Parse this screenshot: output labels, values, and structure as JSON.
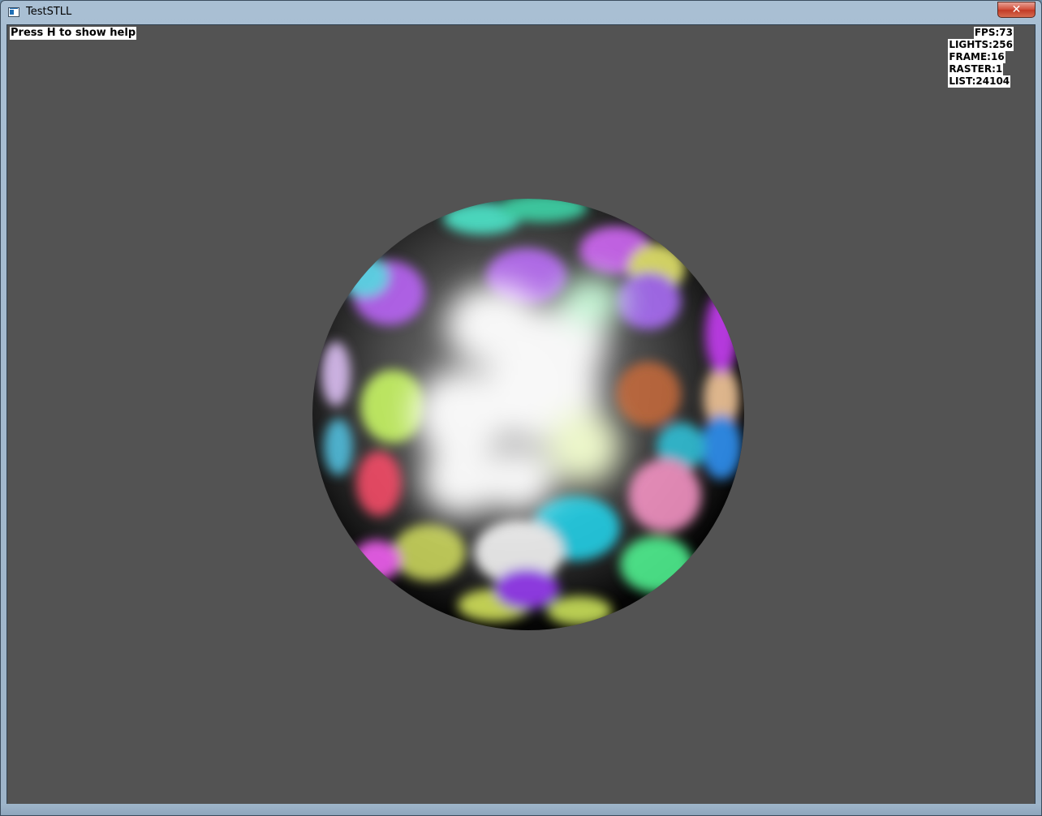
{
  "window": {
    "title": "TestSTLL",
    "close_symbol": "✕",
    "icon": "app-window-icon"
  },
  "overlay": {
    "help": "Press H to show help",
    "stats": [
      "FPS:73",
      "LIGHTS:256",
      "FRAME:16",
      "RASTER:1",
      "LIST:24104"
    ]
  },
  "scene": {
    "background_color": "#535353",
    "object": "lit-sphere",
    "light_colors": [
      "#ffffff",
      "#ff66cc",
      "#33e0e0",
      "#ccff66",
      "#ff4d6a",
      "#b366ff",
      "#3399ff",
      "#c86a3a"
    ]
  }
}
